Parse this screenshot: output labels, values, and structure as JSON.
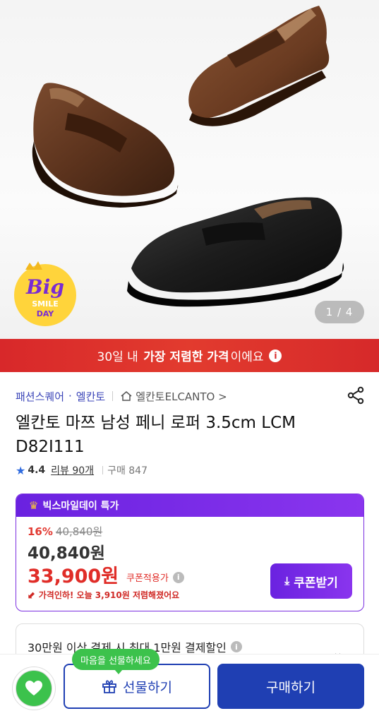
{
  "hero": {
    "counter": "1 / 4",
    "badge": {
      "big": "Big",
      "line1": "SMILE",
      "line2": "DAY"
    }
  },
  "banner": {
    "prefix": "30일 내",
    "bold": "가장 저렴한 가격",
    "suffix": "이에요",
    "info_icon": "i"
  },
  "breadcrumb": {
    "category": "패션스퀘어",
    "brand": "엘칸토",
    "store": "엘칸토ELCANTO >"
  },
  "product": {
    "title": "엘칸토 마쯔 남성 페니 로퍼 3.5cm LCM D82I111",
    "rating": "4.4",
    "reviews": "리뷰 90개",
    "purchases": "구매 847"
  },
  "deal": {
    "header": "빅스마일데이 특가",
    "discount_pct": "16%",
    "original_price": "40,840원",
    "price": "40,840원",
    "coupon_price": "33,900원",
    "coupon_label": "쿠폰적용가",
    "price_drop": "가격인하! 오늘 3,910원 저렴해졌어요",
    "coupon_button": "쿠폰받기"
  },
  "promo": {
    "text": "30만원 이상 결제 시 최대 1만원 결제할인"
  },
  "bottom_bar": {
    "gift_tooltip": "마음을 선물하세요",
    "gift_button": "선물하기",
    "buy_button": "구매하기"
  },
  "colors": {
    "banner_red": "#d8282a",
    "deal_purple": "#7b2fe0",
    "primary_blue": "#1f3fb3",
    "wish_green": "#3cc24c",
    "price_red": "#e02d28"
  }
}
